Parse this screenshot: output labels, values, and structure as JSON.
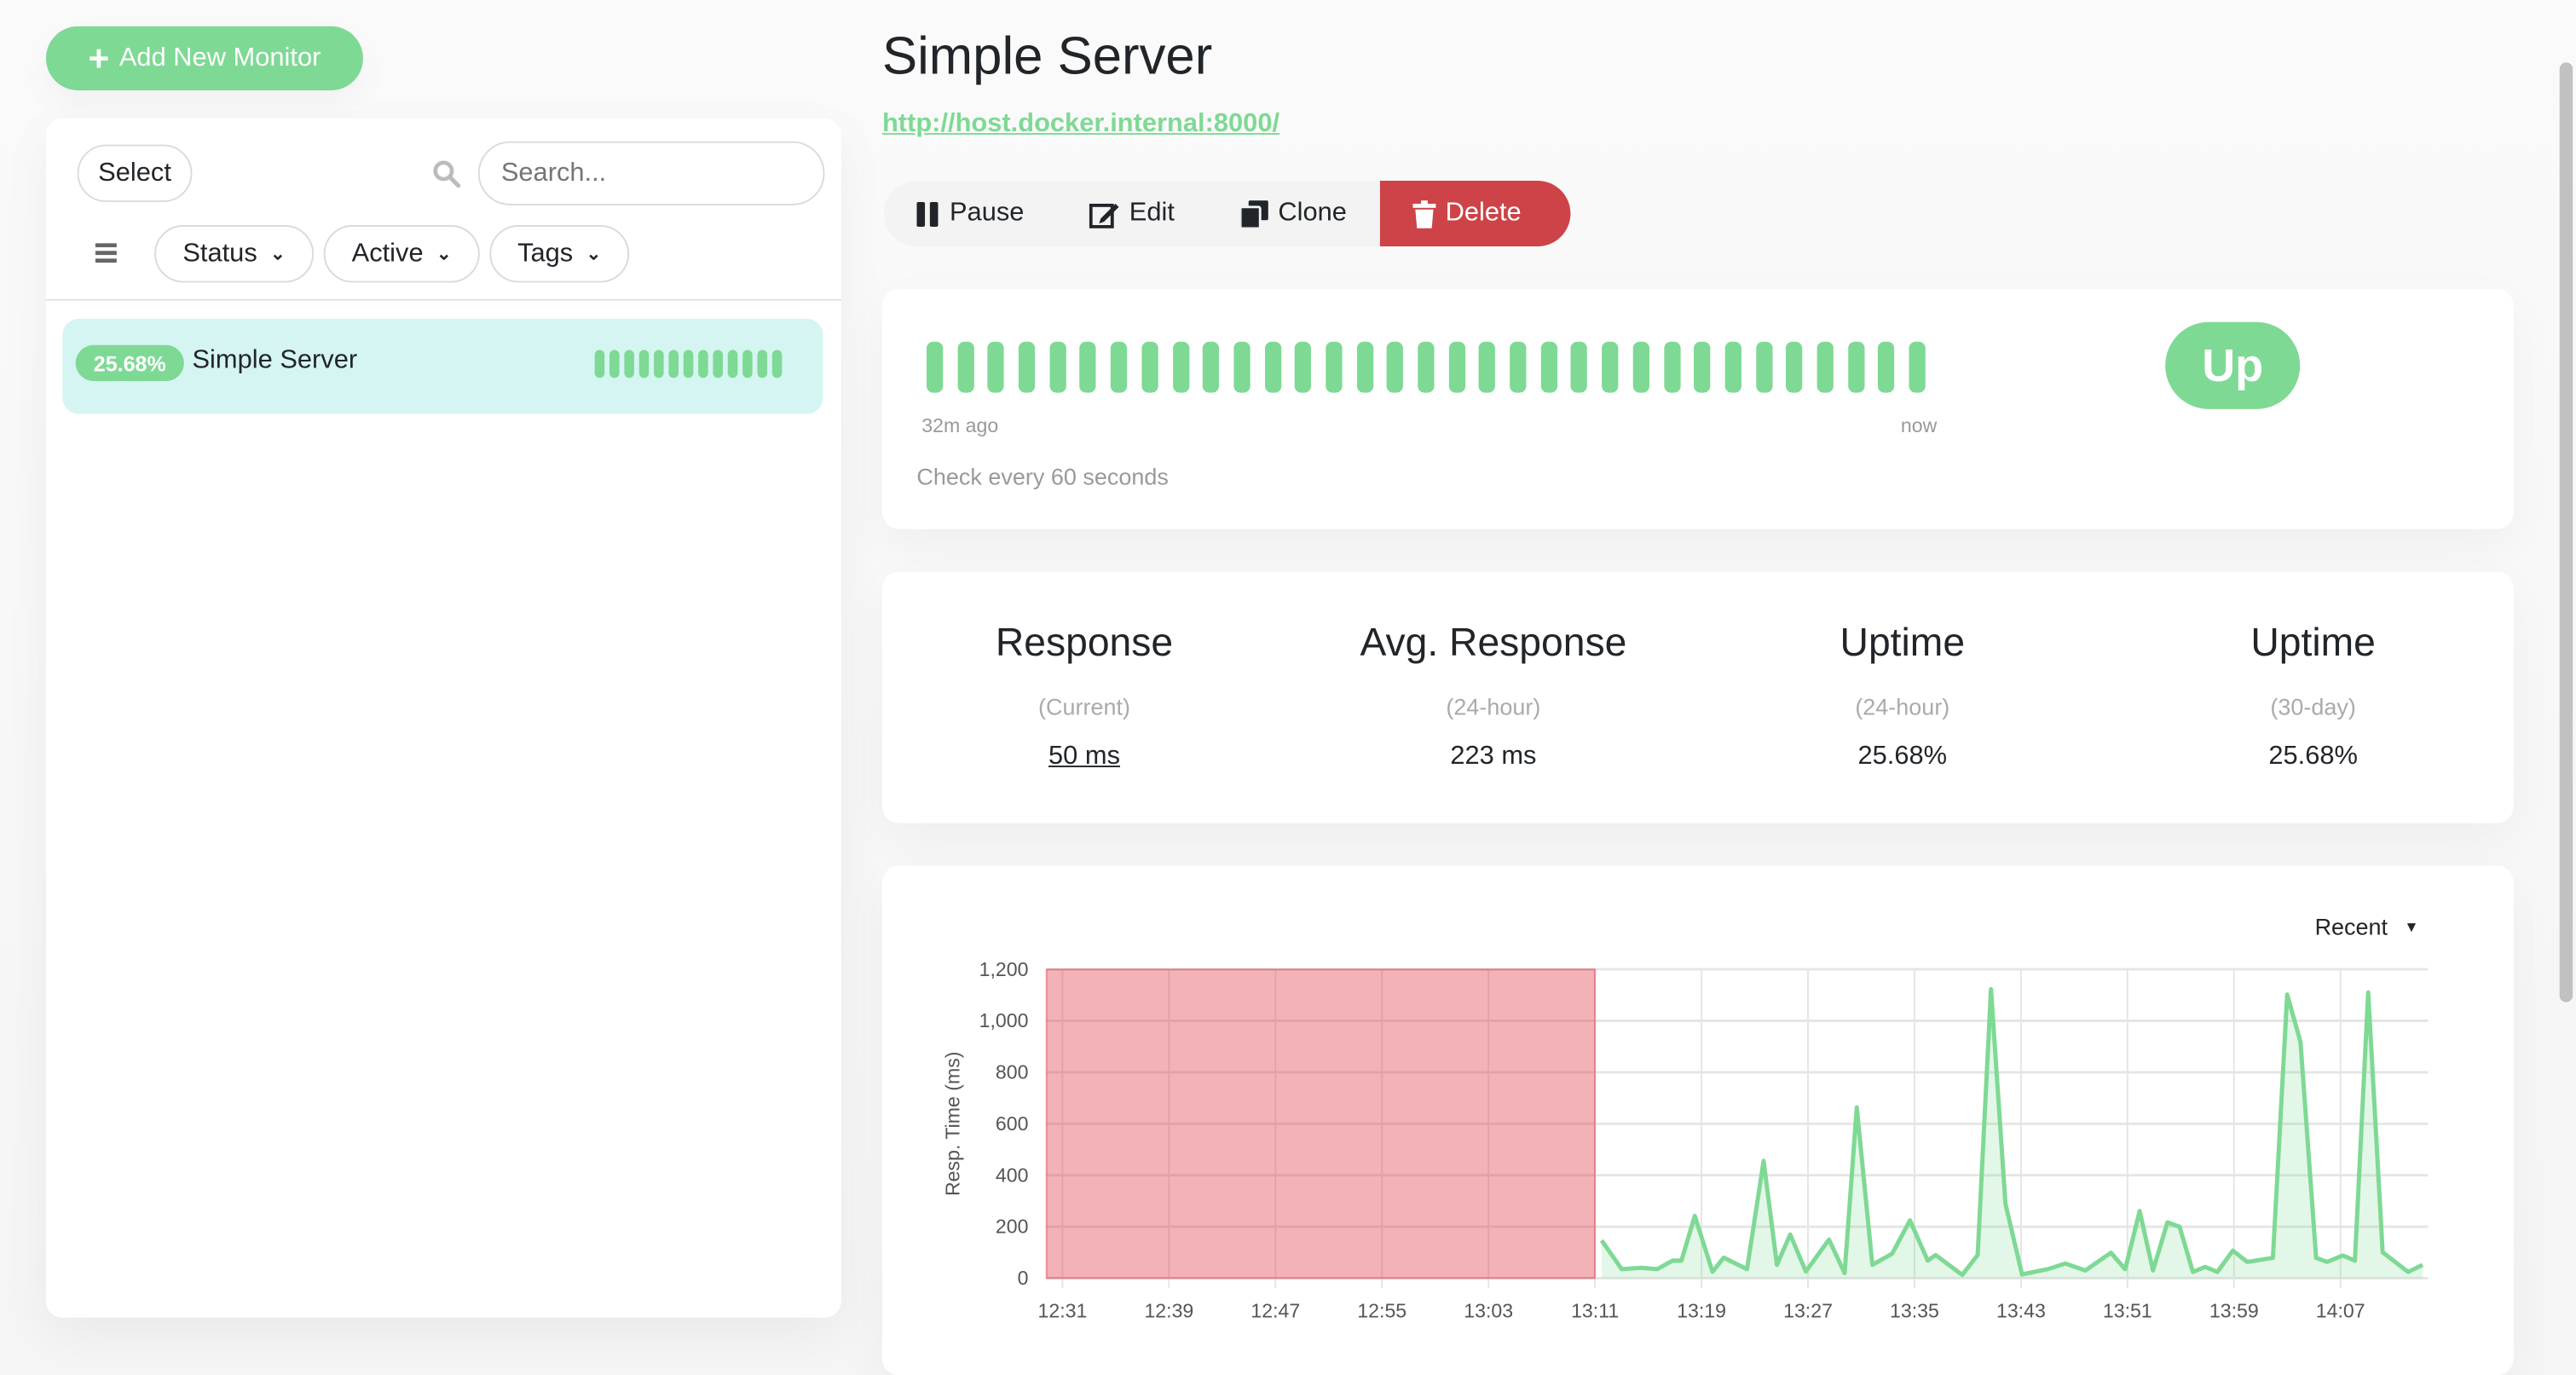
{
  "sidebar": {
    "add_button": "Add New Monitor",
    "select_button": "Select",
    "search_placeholder": "Search...",
    "filters": [
      "Status",
      "Active",
      "Tags"
    ],
    "monitors": [
      {
        "uptime": "25.68%",
        "name": "Simple Server",
        "beats_up": 13,
        "beat_color": "#7ed994"
      }
    ]
  },
  "main": {
    "title": "Simple Server",
    "url": "http://host.docker.internal:8000/",
    "actions": {
      "pause": "Pause",
      "edit": "Edit",
      "clone": "Clone",
      "delete": "Delete"
    },
    "heartbeat": {
      "beats_up": 33,
      "start_label": "32m ago",
      "end_label": "now",
      "interval_text": "Check every 60 seconds",
      "status": "Up"
    },
    "stats": [
      {
        "title": "Response",
        "sub": "(Current)",
        "value": "50 ms"
      },
      {
        "title": "Avg. Response",
        "sub": "(24-hour)",
        "value": "223 ms"
      },
      {
        "title": "Uptime",
        "sub": "(24-hour)",
        "value": "25.68%"
      },
      {
        "title": "Uptime",
        "sub": "(30-day)",
        "value": "25.68%"
      }
    ],
    "range_select": "Recent"
  },
  "colors": {
    "up": "#7ed994",
    "down": "#dc3545",
    "delete": "#cd4348",
    "link": "#7ed994",
    "selected_item": "#d5f5f2"
  },
  "chart_data": {
    "type": "area",
    "ylabel": "Resp. Time (ms)",
    "ylim": [
      0,
      1200
    ],
    "yticks": [
      "0",
      "200",
      "400",
      "600",
      "800",
      "1,000",
      "1,200"
    ],
    "xlim": [
      "12:29:48",
      "14:13:35"
    ],
    "xticks": [
      "12:31",
      "12:39",
      "12:47",
      "12:55",
      "13:03",
      "13:11",
      "13:19",
      "13:27",
      "13:35",
      "13:43",
      "13:51",
      "13:59",
      "14:07"
    ],
    "grid": true,
    "down_periods": [
      {
        "from": "12:29:48",
        "to": "13:11:00"
      }
    ],
    "series": [
      {
        "x": [
          "13:11:30",
          "13:13:00",
          "13:14:30",
          "13:15:40",
          "13:16:50",
          "13:17:30",
          "13:18:30",
          "13:19:50",
          "13:20:40",
          "13:22:25",
          "13:23:40",
          "13:24:40",
          "13:25:40",
          "13:26:50",
          "13:28:35",
          "13:29:45",
          "13:30:40",
          "13:31:50",
          "13:33:20",
          "13:34:40",
          "13:36:00",
          "13:36:35",
          "13:38:35",
          "13:39:45",
          "13:40:45",
          "13:41:50",
          "13:43:05",
          "13:45:00",
          "13:46:20",
          "13:47:50",
          "13:49:45",
          "13:50:50",
          "13:51:55",
          "13:52:55",
          "13:54:00",
          "13:54:55",
          "13:55:55",
          "13:56:50",
          "13:57:45",
          "13:58:55",
          "14:00:00",
          "14:01:55",
          "14:03:00",
          "14:04:00",
          "14:05:10",
          "14:06:00",
          "14:07:10",
          "14:08:05",
          "14:09:05",
          "14:10:10",
          "14:12:05",
          "14:13:10"
        ],
        "y": [
          147,
          35,
          40,
          35,
          68,
          68,
          242,
          25,
          80,
          35,
          456,
          52,
          170,
          26,
          150,
          20,
          663,
          52,
          96,
          225,
          68,
          90,
          13,
          90,
          1123,
          289,
          15,
          35,
          57,
          30,
          99,
          35,
          261,
          30,
          217,
          200,
          24,
          44,
          24,
          107,
          63,
          79,
          1102,
          917,
          79,
          63,
          88,
          68,
          1110,
          101,
          24,
          52
        ]
      }
    ]
  }
}
